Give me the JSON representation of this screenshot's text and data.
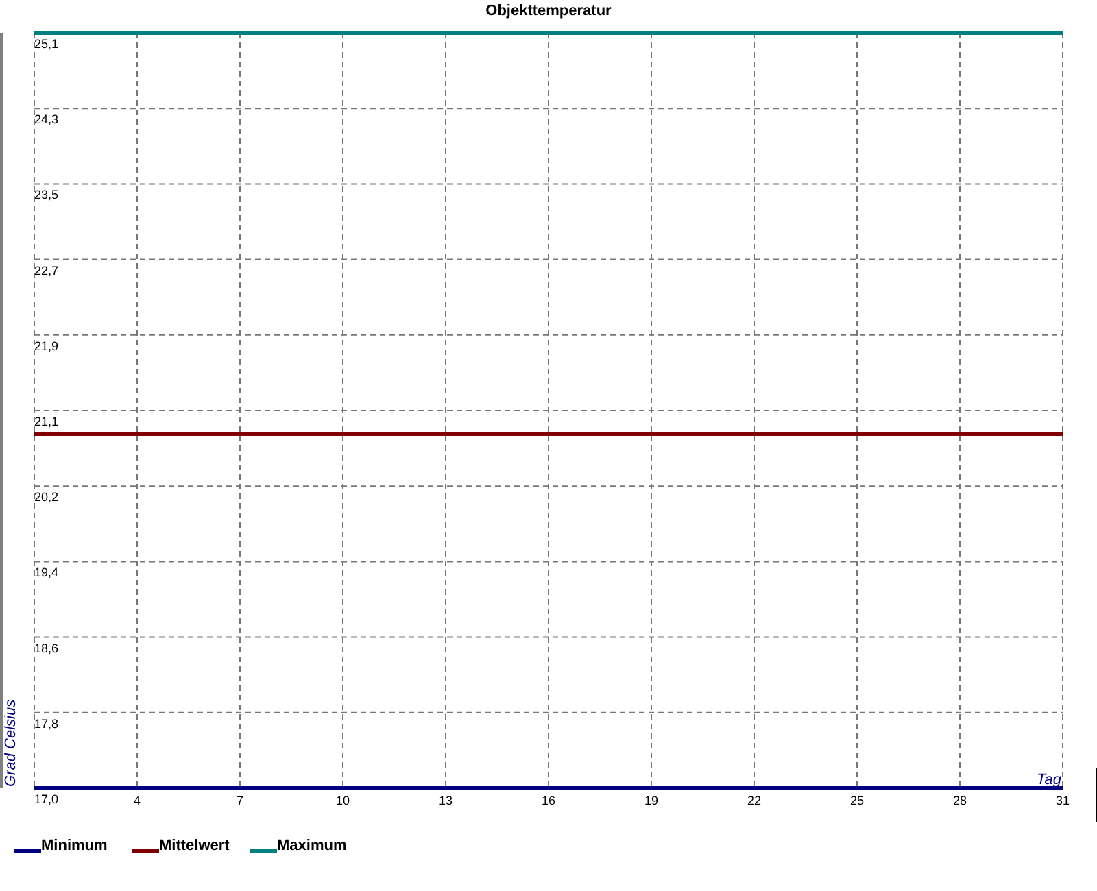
{
  "chart_data": {
    "type": "line",
    "title": "Objekttemperatur",
    "xlabel": "Tag",
    "ylabel": "Grad Celsius",
    "x": [
      1,
      31
    ],
    "series": [
      {
        "name": "Minimum",
        "color": "#000080",
        "values": [
          17.0,
          17.0
        ]
      },
      {
        "name": "Mittelwert",
        "color": "#800000",
        "values": [
          20.8,
          20.8
        ]
      },
      {
        "name": "Maximum",
        "color": "#008080",
        "values": [
          25.1,
          25.1
        ]
      }
    ],
    "grid": true,
    "legend": "bottom",
    "xlim": [
      1,
      31
    ],
    "ylim": [
      17.0,
      25.1
    ],
    "xticks": [
      4,
      7,
      10,
      13,
      16,
      19,
      22,
      25,
      28,
      31
    ],
    "yticks": [
      {
        "value": 17.0,
        "label": "17,0"
      },
      {
        "value": 17.81,
        "label": "17,8"
      },
      {
        "value": 18.62,
        "label": "18,6"
      },
      {
        "value": 19.43,
        "label": "19,4"
      },
      {
        "value": 20.24,
        "label": "20,2"
      },
      {
        "value": 21.05,
        "label": "21,1"
      },
      {
        "value": 21.86,
        "label": "21,9"
      },
      {
        "value": 22.67,
        "label": "22,7"
      },
      {
        "value": 23.48,
        "label": "23,5"
      },
      {
        "value": 24.29,
        "label": "24,3"
      },
      {
        "value": 25.1,
        "label": "25,1"
      }
    ]
  }
}
